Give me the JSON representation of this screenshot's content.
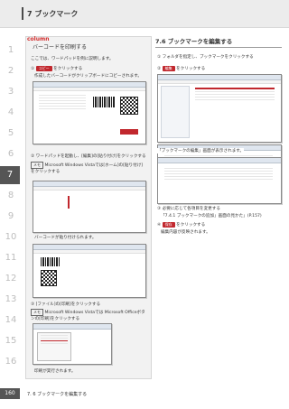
{
  "header": {
    "title": "7 ブックマーク"
  },
  "index": [
    "1",
    "2",
    "3",
    "4",
    "5",
    "6",
    "7",
    "8",
    "9",
    "10",
    "11",
    "12",
    "13",
    "14",
    "15",
    "16"
  ],
  "active_index": "7",
  "column": {
    "label": "column",
    "title": "バーコードを印刷する",
    "intro": "ここでは、ワードパッドを例に説明します。",
    "step1_badge": "コピー",
    "step1_text": "をクリックする",
    "step1_desc": "作成したバーコードがクリップボードにコピーされます。",
    "step2_text": "ワードパッドを起動し、[編集]の[貼り付け]をクリックする",
    "step2_note_tag": "メモ",
    "step2_note": "Microsoft Windows Vistaでは[ホーム]の[貼り付け]をクリックする",
    "step2_result": "バーコードが貼り付けられます。",
    "step3_text": "[ファイル]の[印刷]をクリックする",
    "step3_note_tag": "メモ",
    "step3_note": "Microsoft Windows Vistaでは Microsoft Officeボタンの[印刷]をクリックする",
    "step3_result": "印刷が実行されます。"
  },
  "right": {
    "section_title": "7.6 ブックマークを編集する",
    "step1_text": "フォルダを指定し、ブックマークをクリックする",
    "step2_badge": "編集",
    "step2_text": "をクリックする",
    "step2_result": "「ブックマークの編集」画面が表示されます。",
    "step3_text": "必要に応じて各項目を変更する",
    "step3_desc": "「7.4.1 ブックマークの追加」画面の見かた」(P.157)",
    "step4_badge": "保存",
    "step4_text": "をクリックする",
    "step4_result": "編集内容が反映されます。"
  },
  "footer": {
    "page_number": "160",
    "text": "7. 6 ブックマークを編集する"
  }
}
